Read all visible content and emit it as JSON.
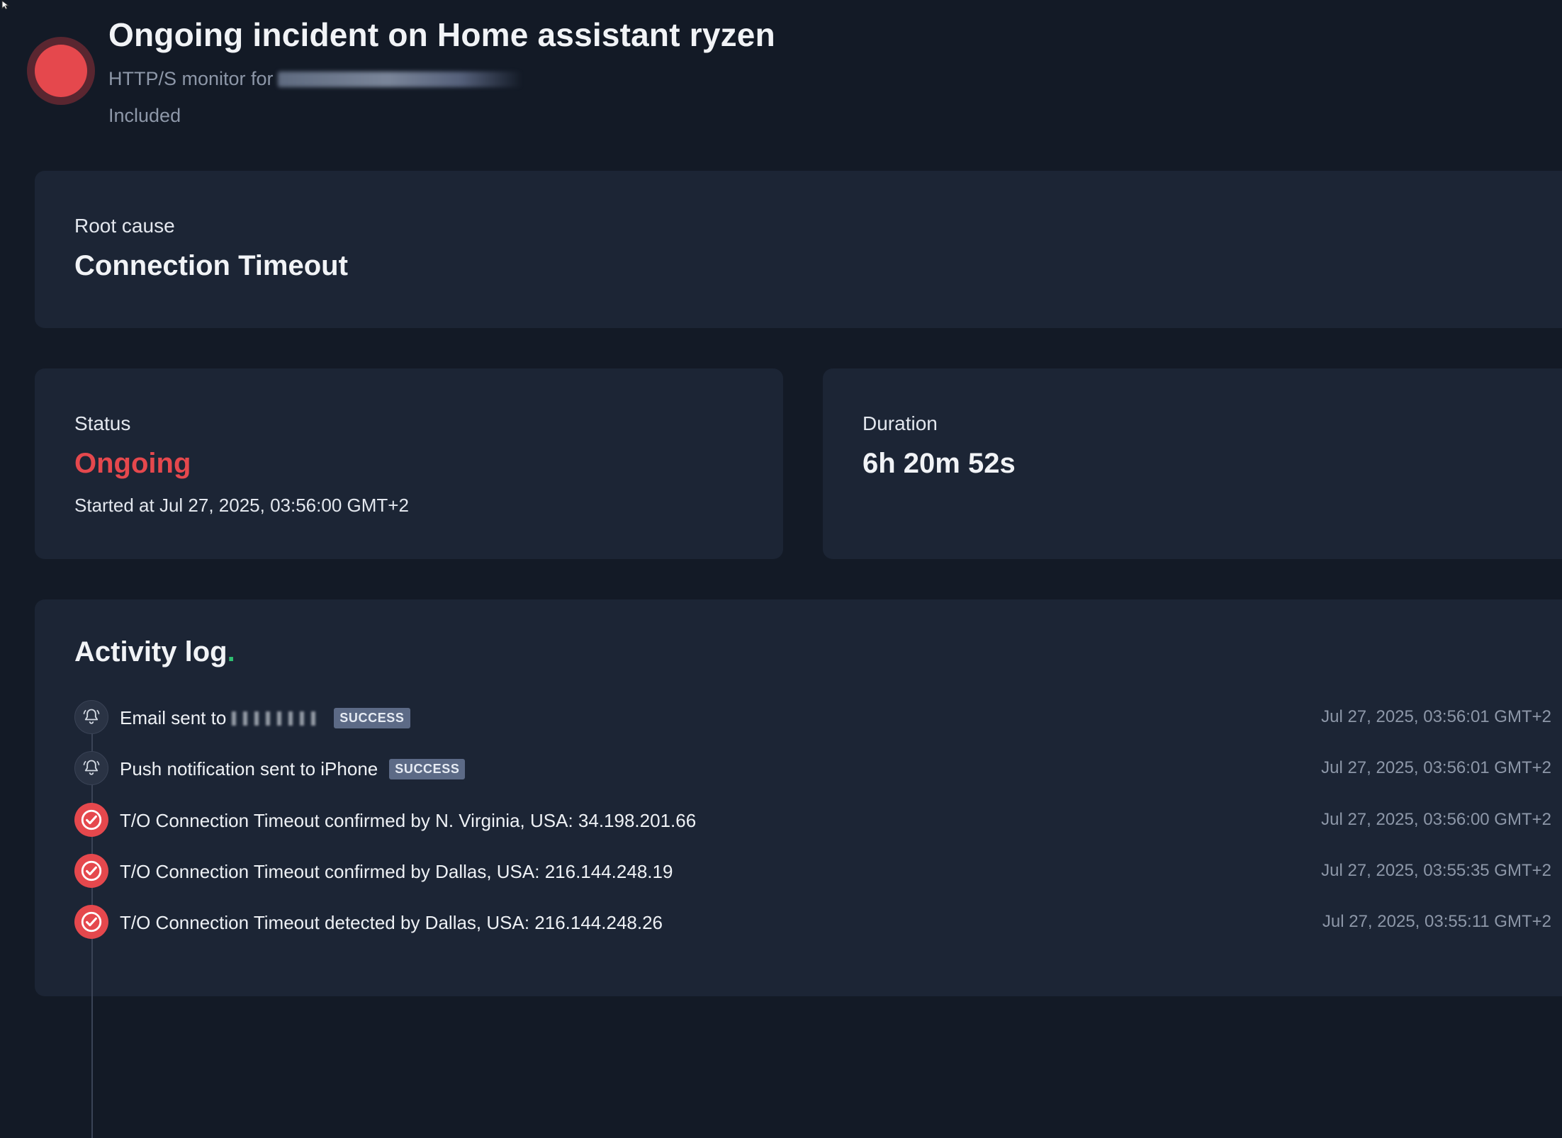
{
  "colors": {
    "background": "#131a26",
    "card": "#1c2535",
    "danger": "#e5484d",
    "accent_dot": "#2fbf71",
    "badge": "#5c6a86",
    "muted_text": "#8d97a8"
  },
  "header": {
    "title": "Ongoing incident on Home assistant ryzen",
    "subtitle_prefix": "HTTP/S monitor for",
    "included": "Included",
    "status_icon": "red-status-dot"
  },
  "root_cause": {
    "label": "Root cause",
    "value": "Connection Timeout"
  },
  "status": {
    "label": "Status",
    "value": "Ongoing",
    "started": "Started at Jul 27, 2025, 03:56:00 GMT+2"
  },
  "duration": {
    "label": "Duration",
    "value": "6h 20m 52s"
  },
  "activity_log": {
    "title": "Activity log",
    "title_dot": ".",
    "items": [
      {
        "icon": "bell-icon",
        "text": "Email sent to",
        "badge": "SUCCESS",
        "time": "Jul 27, 2025, 03:56:01 GMT+2"
      },
      {
        "icon": "bell-icon",
        "text": "Push notification sent to iPhone",
        "badge": "SUCCESS",
        "time": "Jul 27, 2025, 03:56:01 GMT+2"
      },
      {
        "icon": "check-circle-icon",
        "text": "T/O Connection Timeout confirmed by N. Virginia, USA: 34.198.201.66",
        "time": "Jul 27, 2025, 03:56:00 GMT+2"
      },
      {
        "icon": "check-circle-icon",
        "text": "T/O Connection Timeout confirmed by Dallas, USA: 216.144.248.19",
        "time": "Jul 27, 2025, 03:55:35 GMT+2"
      },
      {
        "icon": "check-circle-icon",
        "text": "T/O Connection Timeout detected by Dallas, USA: 216.144.248.26",
        "time": "Jul 27, 2025, 03:55:11 GMT+2"
      }
    ]
  }
}
